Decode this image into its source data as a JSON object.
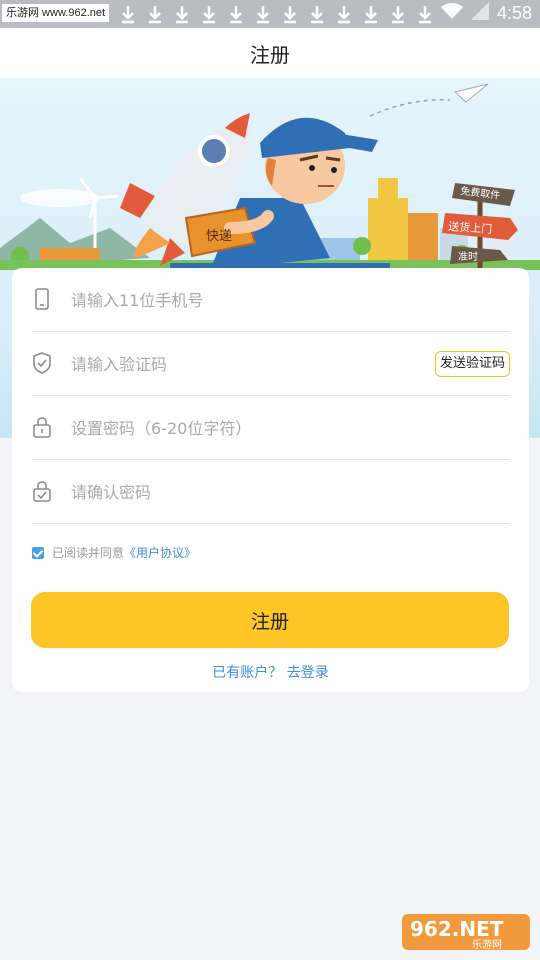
{
  "status_bar": {
    "site": "乐游网 www.962.net",
    "time": "4:58"
  },
  "title": "注册",
  "form": {
    "phone_placeholder": "请输入11位手机号",
    "code_placeholder": "请输入验证码",
    "send_code_label": "发送验证码",
    "password_placeholder": "设置密码（6-20位字符）",
    "confirm_placeholder": "请确认密码",
    "agree_text": "已阅读并同意",
    "agreement_link": "《用户协议》",
    "agreement_checked": true,
    "register_button": "注册",
    "login_link": "已有账户？ 去登录"
  },
  "banner": {
    "box_label": "快递",
    "sign_1": "免费取件",
    "sign_2": "送货上门",
    "sign_3": "准时"
  },
  "watermark": {
    "logo_text": "962.NET",
    "logo_sub": "乐游网"
  },
  "colors": {
    "accent": "#fdc526",
    "link": "#3f8ddd",
    "checkbox": "#4a9ee8"
  }
}
